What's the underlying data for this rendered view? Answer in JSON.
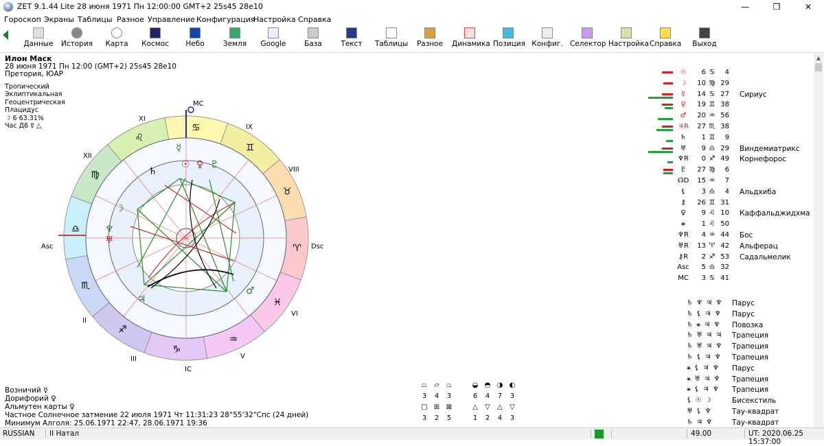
{
  "window": {
    "title": "ZET 9.1.44 Lite   28 июня 1971  Пн  12:00:00 GMT+2 25s45  28e10",
    "minimize": "—",
    "maximize": "❐",
    "close": "✕"
  },
  "menu": [
    "Гороскоп",
    "Экраны",
    "Таблицы",
    "Разное",
    "Управление",
    "Конфигурация",
    "Настройка",
    "Справка"
  ],
  "toolbar": [
    {
      "label": "Данные",
      "icon": "data-icon"
    },
    {
      "label": "История",
      "icon": "history-icon"
    },
    {
      "label": "Карта",
      "icon": "chart-icon"
    },
    {
      "label": "Космос",
      "icon": "cosmos-icon"
    },
    {
      "label": "Небо",
      "icon": "sky-icon"
    },
    {
      "label": "Земля",
      "icon": "earth-icon"
    },
    {
      "label": "Google",
      "icon": "google-icon"
    },
    {
      "label": "База",
      "icon": "database-icon"
    },
    {
      "label": "Текст",
      "icon": "text-icon"
    },
    {
      "label": "Таблицы",
      "icon": "tables-icon"
    },
    {
      "label": "Разное",
      "icon": "misc-icon"
    },
    {
      "label": "Динамика",
      "icon": "dynamics-icon"
    },
    {
      "label": "Позиция",
      "icon": "position-icon"
    },
    {
      "label": "Конфиг.",
      "icon": "config-icon"
    },
    {
      "label": "Селектор",
      "icon": "selector-icon"
    },
    {
      "label": "Настройка",
      "icon": "settings-icon"
    },
    {
      "label": "Справка",
      "icon": "help-icon"
    },
    {
      "label": "Выход",
      "icon": "exit-icon"
    }
  ],
  "info": {
    "name": "Илон Маск",
    "date": "28 июня 1971  Пн  12:00  (GMT+2) 25s45  28e10",
    "place": "Претория, ЮАР",
    "zodiac": "Тропический",
    "coords": "Эклиптикальная",
    "center": "Геоцентрическая",
    "houses": "Плацидус",
    "moon": "☽   6 63.31%",
    "hour": "Час Д6  ☿  △"
  },
  "wheel": {
    "mc": "MC",
    "ic": "IC",
    "asc": "Asc",
    "dsc": "Dsc",
    "houses": [
      "XII",
      "XI",
      "IX",
      "VIII",
      "VI",
      "V",
      "III",
      "II"
    ],
    "signs": [
      "♋",
      "♊",
      "♉",
      "♈",
      "♓",
      "♒",
      "♑",
      "♐",
      "♏",
      "♎",
      "♍",
      "♌"
    ],
    "planets": [
      "☿",
      "☉",
      "♀",
      "♂",
      "♃",
      "♄",
      "♅",
      "♆",
      "♇",
      "☽"
    ]
  },
  "planets": [
    {
      "glyph": "☉",
      "deg": "6",
      "sign": "♋",
      "min": "4",
      "star": "",
      "c": "#d02020"
    },
    {
      "glyph": "☽",
      "deg": "10",
      "sign": "♍",
      "min": "29",
      "star": "",
      "c": "#d02020"
    },
    {
      "glyph": "☿",
      "deg": "14",
      "sign": "♋",
      "min": "27",
      "star": "Сириус",
      "c": "#d02020"
    },
    {
      "glyph": "♀",
      "deg": "19",
      "sign": "♊",
      "min": "38",
      "star": "",
      "c": "#d02020"
    },
    {
      "glyph": "♂",
      "deg": "20",
      "sign": "♒",
      "min": "56",
      "star": "",
      "c": "#d02020"
    },
    {
      "glyph": "♃R",
      "deg": "27",
      "sign": "♏",
      "min": "38",
      "star": "",
      "c": "#d02020"
    },
    {
      "glyph": "♄",
      "deg": "1",
      "sign": "♊",
      "min": "9",
      "star": "",
      "c": "#000"
    },
    {
      "glyph": "♅",
      "deg": "9",
      "sign": "♎",
      "min": "29",
      "star": "Виндемиатрикс",
      "c": "#000"
    },
    {
      "glyph": "♆R",
      "deg": "0",
      "sign": "♐",
      "min": "49",
      "star": "Корнефорос",
      "c": "#000"
    },
    {
      "glyph": "♇",
      "deg": "27",
      "sign": "♍",
      "min": "6",
      "star": "",
      "c": "#000"
    },
    {
      "glyph": "☊D",
      "deg": "15",
      "sign": "♒",
      "min": "7",
      "star": "",
      "c": "#000"
    },
    {
      "glyph": "⚸",
      "deg": "3",
      "sign": "♎",
      "min": "4",
      "star": "Альдхиба",
      "c": "#000"
    },
    {
      "glyph": "⚷",
      "deg": "26",
      "sign": "♊",
      "min": "31",
      "star": "",
      "c": "#000"
    },
    {
      "glyph": "♀",
      "deg": "9",
      "sign": "♌",
      "min": "10",
      "star": "Каффальджидхма",
      "c": "#000"
    },
    {
      "glyph": "⚹",
      "deg": "1",
      "sign": "♌",
      "min": "50",
      "star": "",
      "c": "#000"
    },
    {
      "glyph": "♆R",
      "deg": "4",
      "sign": "♒",
      "min": "44",
      "star": "Бос",
      "c": "#000"
    },
    {
      "glyph": "♅R",
      "deg": "13",
      "sign": "♈",
      "min": "42",
      "star": "Альферац",
      "c": "#000"
    },
    {
      "glyph": "⚷R",
      "deg": "2",
      "sign": "♐",
      "min": "53",
      "star": "Садальмелик",
      "c": "#000"
    },
    {
      "glyph": "Asc",
      "deg": "5",
      "sign": "♎",
      "min": "32",
      "star": "",
      "c": "#000"
    },
    {
      "glyph": "MC",
      "deg": "3",
      "sign": "♋",
      "min": "41",
      "star": "",
      "c": "#000"
    }
  ],
  "bars": [
    {
      "red": 0.4,
      "green": 0.0
    },
    {
      "red": 0.35,
      "green": 0.0
    },
    {
      "red": 0.4,
      "green": 0.9
    },
    {
      "red": 0.4,
      "green": 0.3
    },
    {
      "red": 0.0,
      "green": 0.55
    },
    {
      "red": 0.4,
      "green": 0.6
    },
    {
      "red": 0.0,
      "green": 0.25
    },
    {
      "red": 0.4,
      "green": 0.9
    },
    {
      "red": 0.0,
      "green": 0.2
    },
    {
      "red": 0.35,
      "green": 0.35
    }
  ],
  "figures": [
    {
      "glyphs": "♄ ♆ ♃ ♆",
      "name": "Парус"
    },
    {
      "glyphs": "♄ ⚸ ♃ ♆",
      "name": "Парус"
    },
    {
      "glyphs": "♄ ⚹ ♃ ♆",
      "name": "Повозка"
    },
    {
      "glyphs": "♄ ♅ ♃ ♃",
      "name": "Трапеция"
    },
    {
      "glyphs": "♄ ♅ ♃ ♆",
      "name": "Трапеция"
    },
    {
      "glyphs": "♄ ⚸ ♃ ♆",
      "name": "Трапеция"
    },
    {
      "glyphs": "⚹ ⚸ ♃ ♆",
      "name": "Парус"
    },
    {
      "glyphs": "⚹ ♅ ♃ ♆",
      "name": "Трапеция"
    },
    {
      "glyphs": "⚹ ⚸ ♃ ♆",
      "name": "Трапеция"
    },
    {
      "glyphs": "⚸ ☉ ☽",
      "name": "Бисекстиль"
    },
    {
      "glyphs": "♅ ⚸ ♆",
      "name": "Тау-квадрат"
    },
    {
      "glyphs": "♄ ♃ ♆",
      "name": "Тау-квадрат"
    }
  ],
  "bottom": {
    "l1": "Возничий  ☿",
    "l2": "Дорифорий  ♀",
    "l3": "Альмутен карты  ♀",
    "l4": "Частное Солнечное затмение 22 июля 1971 Чт 11:31:23 28°55'32\"Спс (24 дней)",
    "l5": "Минимум Алголя: 25.06.1971 22:47,  28.06.1971 19:36"
  },
  "elements": {
    "row1_syms": [
      "⏢",
      "⏥",
      "⏢",
      "◒",
      "◓",
      "◑",
      "◐"
    ],
    "row1_vals": [
      "3",
      "4",
      "3",
      "6",
      "4",
      "7",
      "3"
    ],
    "row2_syms": [
      "□",
      "⊞",
      "⊠",
      "△",
      "▽",
      "△",
      "▽"
    ],
    "row2_vals": [
      "3",
      "2",
      "5",
      "1",
      "2",
      "4",
      "3"
    ]
  },
  "status": {
    "lang": "RUSSIAN",
    "mode": "II Натал",
    "value": "49.00",
    "ut": "UT: 2020.06.25 15:37:00"
  },
  "colors": {
    "accent": "#0a8a2a",
    "red": "#d02020",
    "green": "#21a33a"
  }
}
